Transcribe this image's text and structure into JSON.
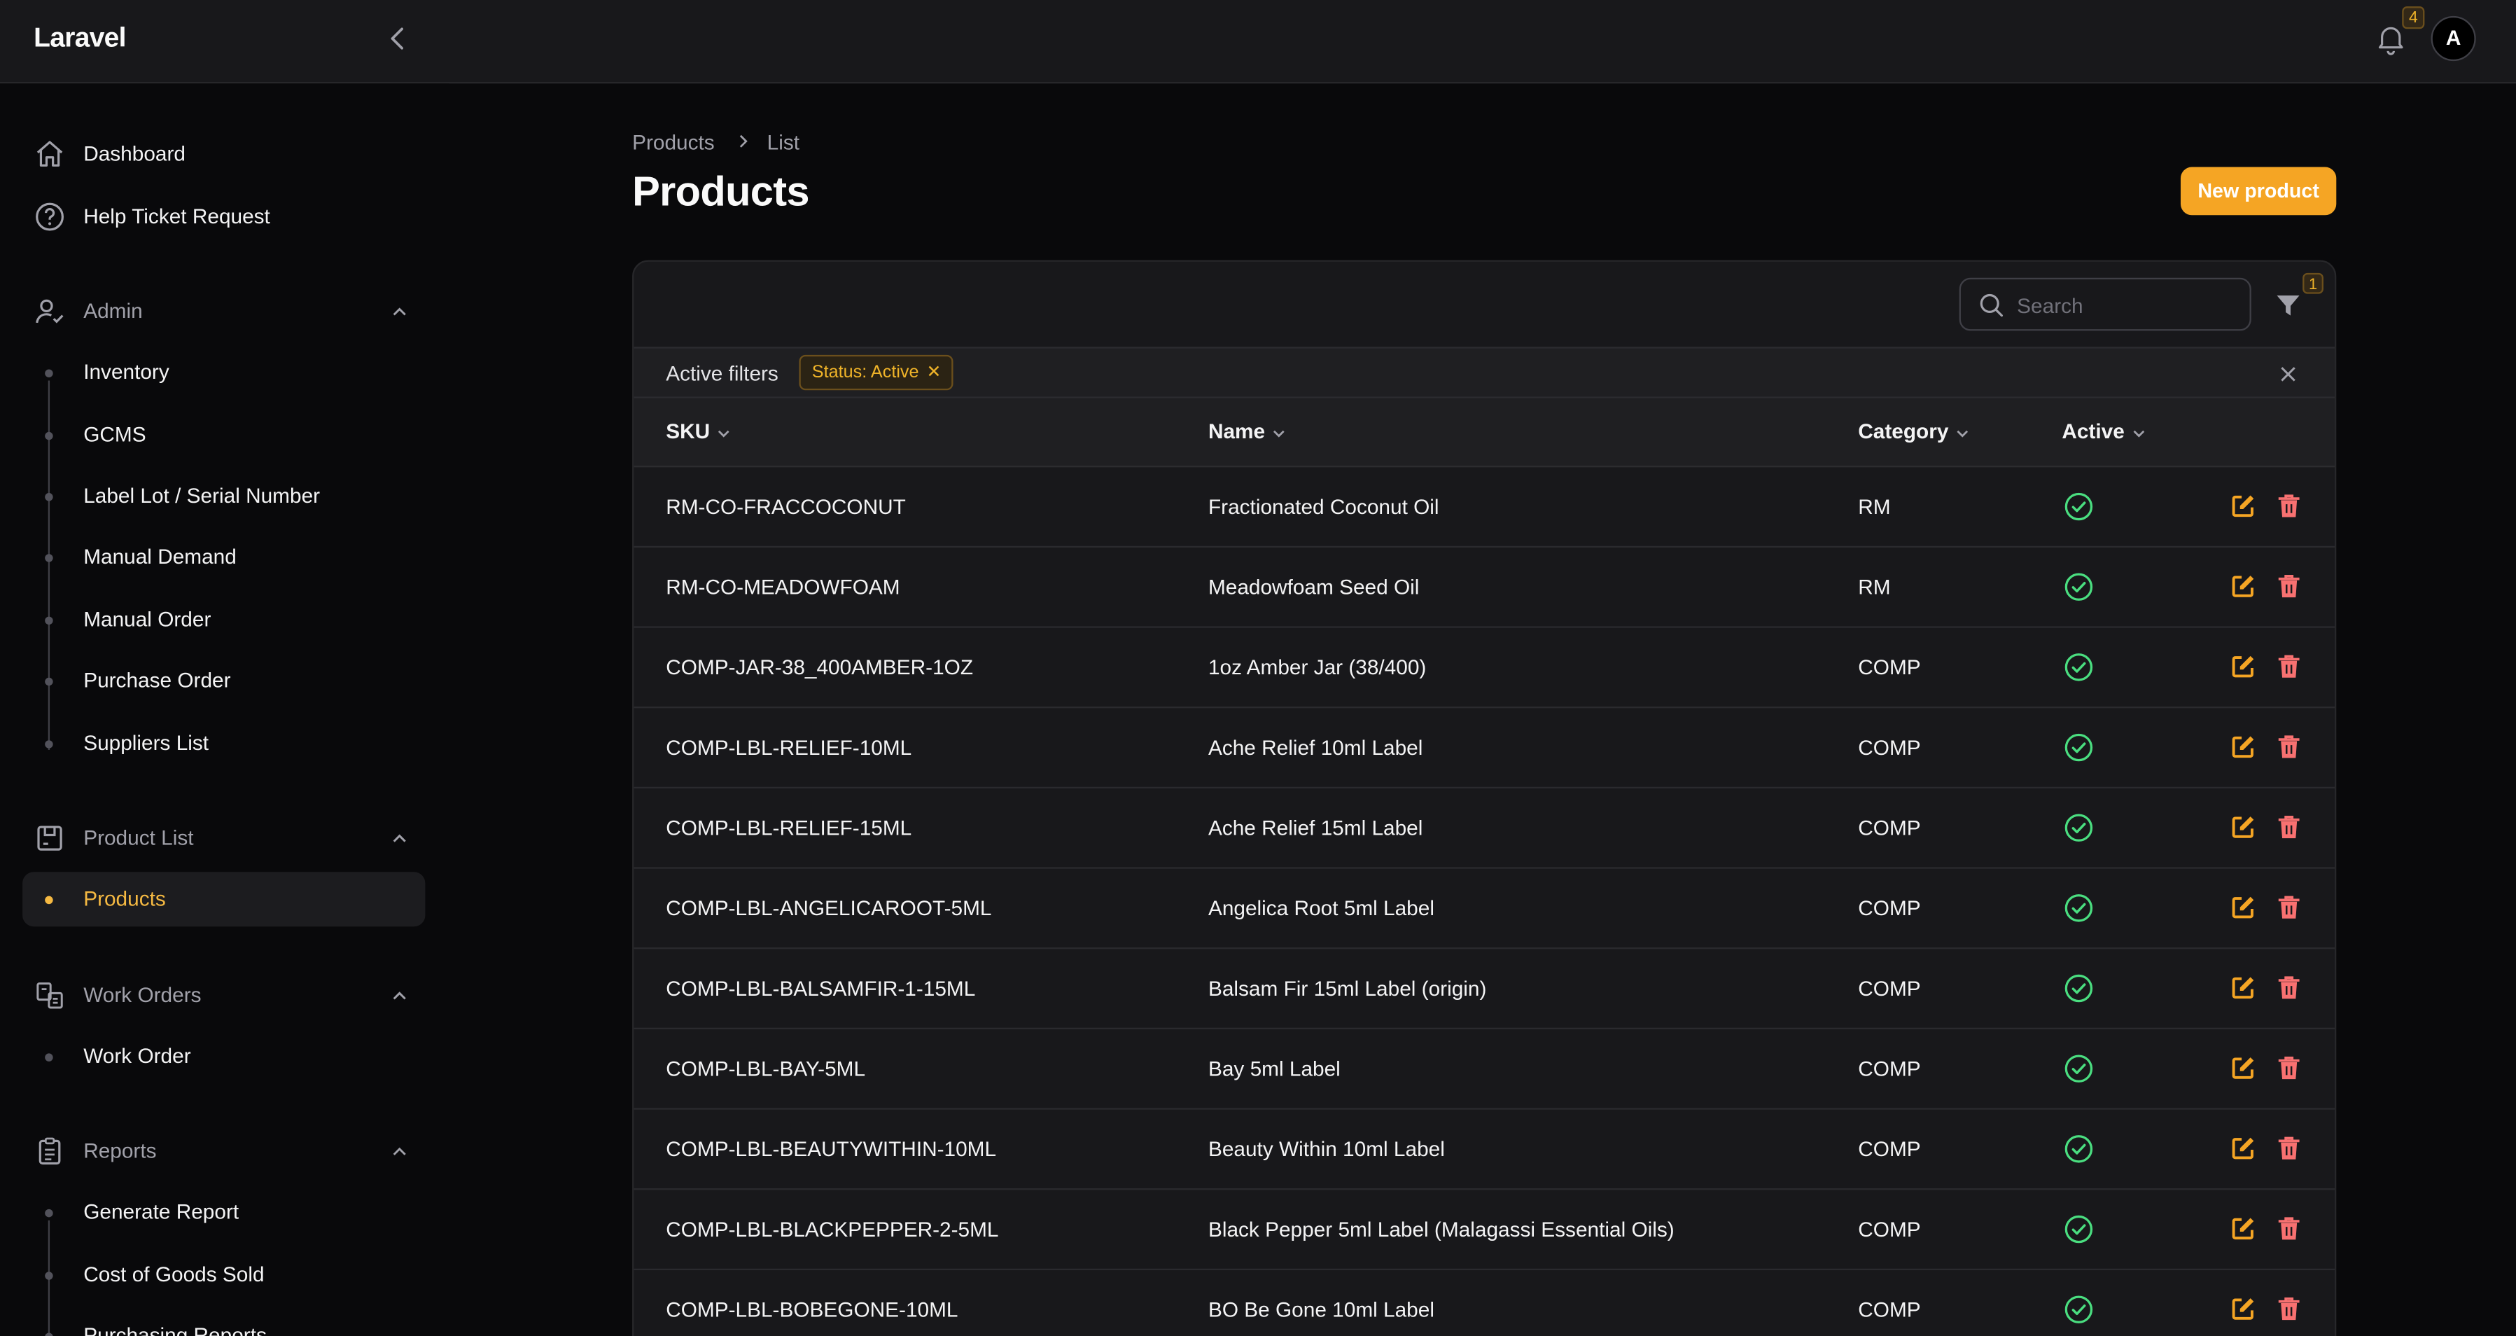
{
  "app": {
    "brand": "Laravel",
    "notifications_count": "4",
    "avatar_initial": "A"
  },
  "sidebar": {
    "top_items": [
      {
        "label": "Dashboard",
        "icon": "home-icon"
      },
      {
        "label": "Help Ticket Request",
        "icon": "question-circle-icon"
      }
    ],
    "groups": [
      {
        "label": "Admin",
        "icon": "user-check-icon",
        "items": [
          "Inventory",
          "GCMS",
          "Label Lot / Serial Number",
          "Manual Demand",
          "Manual Order",
          "Purchase Order",
          "Suppliers List"
        ]
      },
      {
        "label": "Product List",
        "icon": "box-icon",
        "items": [
          "Products"
        ]
      },
      {
        "label": "Work Orders",
        "icon": "work-order-icon",
        "items": [
          "Work Order"
        ]
      },
      {
        "label": "Reports",
        "icon": "clipboard-icon",
        "items": [
          "Generate Report",
          "Cost of Goods Sold",
          "Purchasing Reports"
        ]
      }
    ],
    "active_item": "Products"
  },
  "breadcrumb": {
    "parent": "Products",
    "current": "List"
  },
  "page": {
    "title": "Products",
    "new_button": "New product"
  },
  "table": {
    "search_placeholder": "Search",
    "filter_count": "1",
    "active_filters_label": "Active filters",
    "filter_chip": "Status: Active",
    "columns": [
      "SKU",
      "Name",
      "Category",
      "Active"
    ],
    "rows": [
      {
        "sku": "RM-CO-FRACCOCONUT",
        "name": "Fractionated Coconut Oil",
        "category": "RM",
        "active": true
      },
      {
        "sku": "RM-CO-MEADOWFOAM",
        "name": "Meadowfoam Seed Oil",
        "category": "RM",
        "active": true
      },
      {
        "sku": "COMP-JAR-38_400AMBER-1OZ",
        "name": "1oz Amber Jar (38/400)",
        "category": "COMP",
        "active": true
      },
      {
        "sku": "COMP-LBL-RELIEF-10ML",
        "name": "Ache Relief 10ml Label",
        "category": "COMP",
        "active": true
      },
      {
        "sku": "COMP-LBL-RELIEF-15ML",
        "name": "Ache Relief 15ml Label",
        "category": "COMP",
        "active": true
      },
      {
        "sku": "COMP-LBL-ANGELICAROOT-5ML",
        "name": "Angelica Root 5ml Label",
        "category": "COMP",
        "active": true
      },
      {
        "sku": "COMP-LBL-BALSAMFIR-1-15ML",
        "name": "Balsam Fir 15ml Label (origin)",
        "category": "COMP",
        "active": true
      },
      {
        "sku": "COMP-LBL-BAY-5ML",
        "name": "Bay 5ml Label",
        "category": "COMP",
        "active": true
      },
      {
        "sku": "COMP-LBL-BEAUTYWITHIN-10ML",
        "name": "Beauty Within 10ml Label",
        "category": "COMP",
        "active": true
      },
      {
        "sku": "COMP-LBL-BLACKPEPPER-2-5ML",
        "name": "Black Pepper 5ml Label (Malagassi Essential Oils)",
        "category": "COMP",
        "active": true
      },
      {
        "sku": "COMP-LBL-BOBEGONE-10ML",
        "name": "BO Be Gone 10ml Label",
        "category": "COMP",
        "active": true
      }
    ]
  },
  "colors": {
    "accent": "#f5a524",
    "success": "#4ade80",
    "danger": "#f87171",
    "background": "#09090b",
    "surface": "#18181b"
  }
}
